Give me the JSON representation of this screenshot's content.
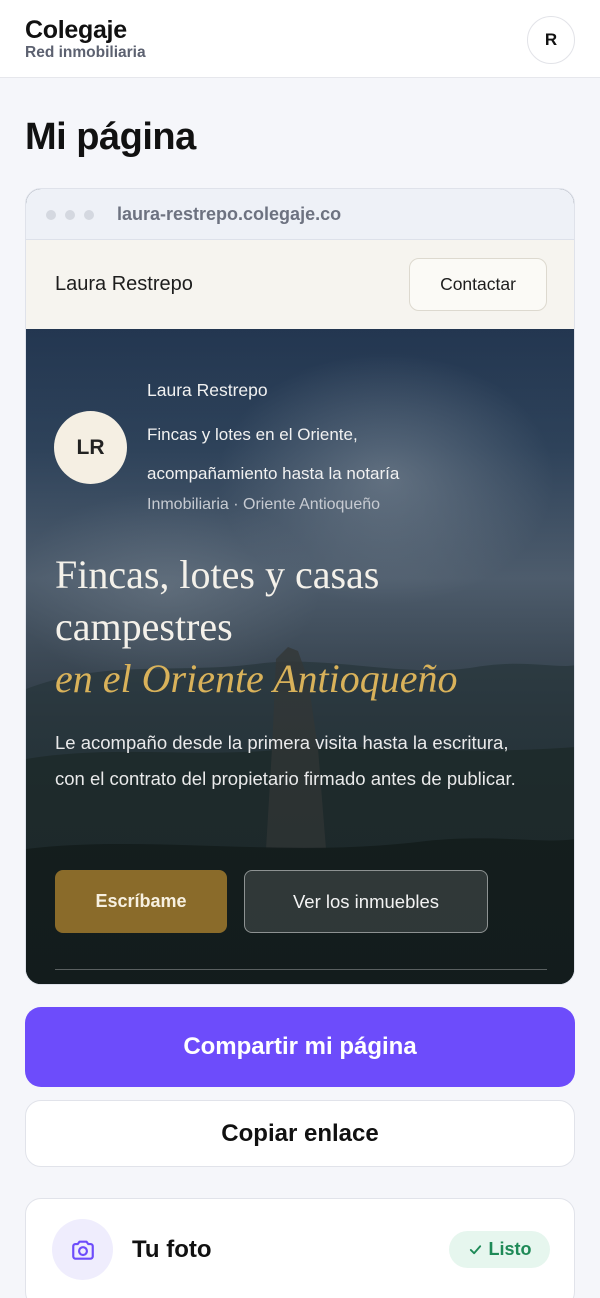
{
  "app": {
    "name": "Colegaje",
    "subtitle": "Red inmobiliaria",
    "user_initial": "R"
  },
  "page_title": "Mi página",
  "preview": {
    "url": "laura-restrepo.colegaje.co",
    "site_name": "Laura Restrepo",
    "contact_label": "Contactar",
    "hero": {
      "initials": "LR",
      "agent_name": "Laura Restrepo",
      "tagline": "Fincas y lotes en el Oriente, acompañamiento hasta la notaría",
      "meta": "Inmobiliaria · Oriente Antioqueño",
      "headline": "Fincas, lotes y casas campestres",
      "headline_accent": "en el Oriente Antioqueño",
      "description": "Le acompaño desde la primera visita hasta la escritura, con el contrato del propietario firmado antes de publicar.",
      "primary_cta": "Escríbame",
      "secondary_cta": "Ver los inmuebles"
    }
  },
  "actions": {
    "share_label": "Compartir mi página",
    "copy_label": "Copiar enlace"
  },
  "checklist": {
    "photo_label": "Tu foto",
    "photo_icon": "camera-icon",
    "status_label": "Listo",
    "status_icon": "check-icon"
  },
  "colors": {
    "accent": "#6d4cfb",
    "gold": "#d9b25a",
    "success": "#1e8a57"
  }
}
